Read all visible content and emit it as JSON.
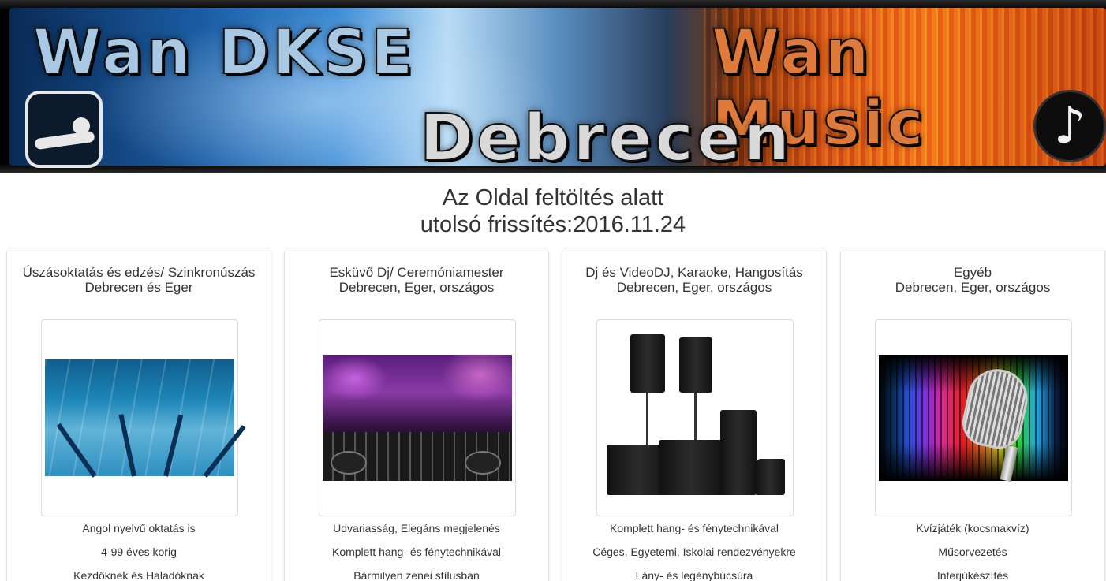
{
  "banner": {
    "left_text": "Wan DKSE",
    "right_text": "Wan Music",
    "center_text": "Debrecen",
    "music_symbol": "♪",
    "icons": [
      "swimmer-logo-icon",
      "music-note-icon"
    ]
  },
  "headline": {
    "line1": "Az Oldal feltöltés alatt",
    "line2": "utolsó frissítés:2016.11.24"
  },
  "cards": [
    {
      "title1": "Úszásoktatás és edzés/ Szinkronúszás",
      "title2": "Debrecen és Eger",
      "image": "swimming-pool-image",
      "items": [
        "Angol nyelvű oktatás is",
        "4-99 éves korig",
        "Kezdőknek és Haladóknak"
      ]
    },
    {
      "title1": "Esküvő Dj/ Ceremóniamester",
      "title2": "Debrecen, Eger, országos",
      "image": "dj-party-image",
      "items": [
        "Udvariasság, Elegáns megjelenés",
        "Komplett hang- és fénytechnikával",
        "Bármilyen zenei stílusban"
      ]
    },
    {
      "title1": "Dj és VideoDJ, Karaoke, Hangosítás",
      "title2": "Debrecen, Eger, országos",
      "image": "speakers-image",
      "items": [
        "Komplett hang- és fénytechnikával",
        "Céges, Egyetemi, Iskolai rendezvényekre",
        "Lány- és legénybúcsúra"
      ]
    },
    {
      "title1": "Egyéb",
      "title2": "Debrecen, Eger, országos",
      "image": "microphone-image",
      "items": [
        "Kvízjáték (kocsmakvíz)",
        "Műsorvezetés",
        "Interjúkészítés"
      ]
    }
  ]
}
